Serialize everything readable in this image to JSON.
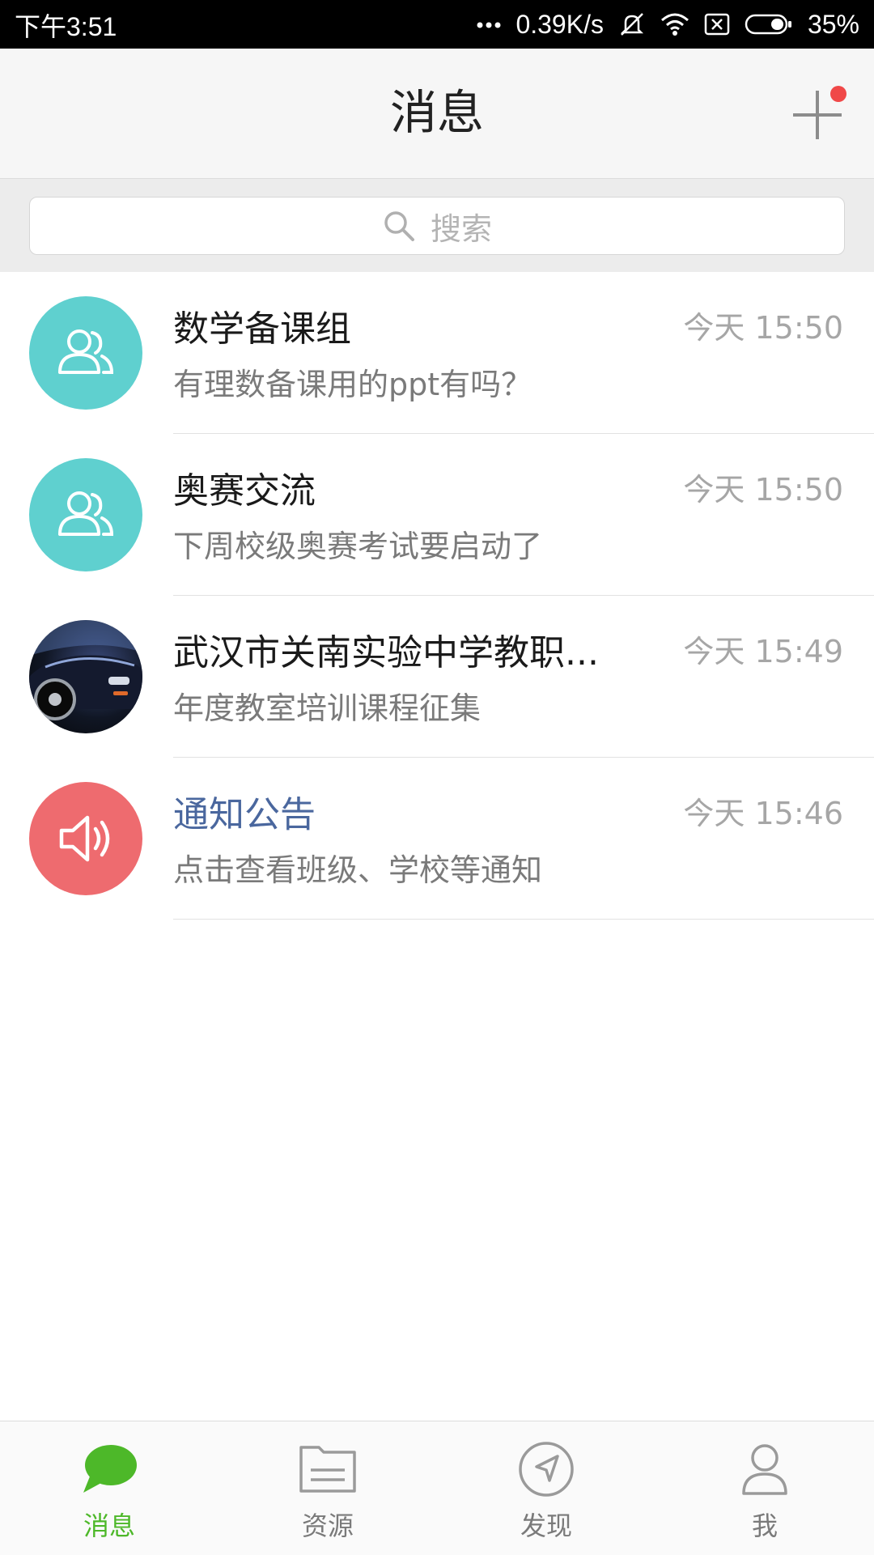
{
  "status_bar": {
    "time": "下午3:51",
    "net_speed": "0.39K/s",
    "battery_percent": "35%",
    "icons": [
      "dots-icon",
      "mute-icon",
      "wifi-icon",
      "sim-icon",
      "battery-icon"
    ]
  },
  "header": {
    "title": "消息",
    "action_icon": "plus-icon",
    "badge_color": "#f04848"
  },
  "search": {
    "placeholder": "搜索",
    "icon": "search-icon"
  },
  "conversations": [
    {
      "title": "数学备课组",
      "preview": "有理数备课用的ppt有吗？",
      "date": "今天",
      "time": "15:50",
      "avatar": "group-icon"
    },
    {
      "title": "奥赛交流",
      "preview": "下周校级奥赛考试要启动了",
      "date": "今天",
      "time": "15:50",
      "avatar": "group-icon"
    },
    {
      "title": "武汉市关南实验中学教职...",
      "preview": "年度教室培训课程征集",
      "date": "今天",
      "time": "15:49",
      "avatar": "car-photo"
    },
    {
      "title": "通知公告",
      "preview": "点击查看班级、学校等通知",
      "date": "今天",
      "time": "15:46",
      "avatar": "speaker-icon"
    }
  ],
  "tabs": [
    {
      "label": "消息",
      "icon": "chat-bubble-icon",
      "active": true
    },
    {
      "label": "资源",
      "icon": "folder-icon",
      "active": false
    },
    {
      "label": "发现",
      "icon": "compass-icon",
      "active": false
    },
    {
      "label": "我",
      "icon": "person-icon",
      "active": false
    }
  ],
  "colors": {
    "accent_green": "#4db829",
    "group_avatar": "#5fd0cf",
    "notice_avatar": "#ee6b6f",
    "notice_title": "#4a679e"
  }
}
